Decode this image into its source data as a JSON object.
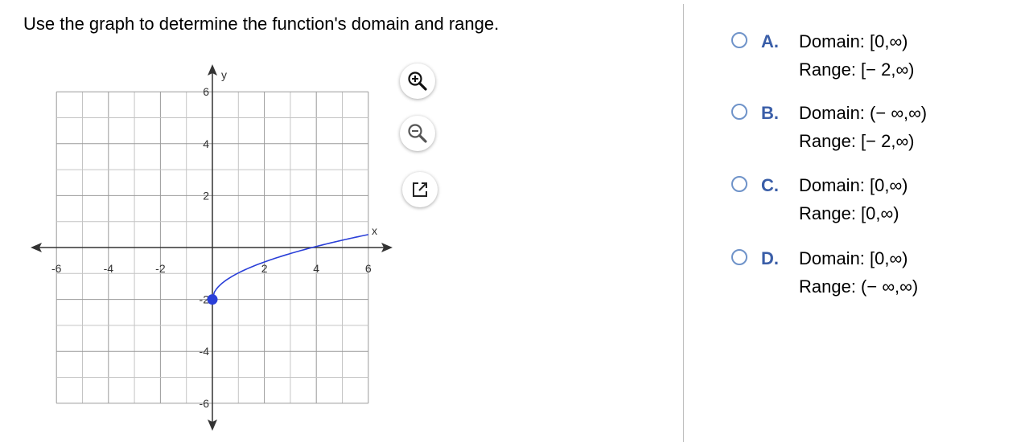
{
  "question": "Use the graph to determine the function's domain and range.",
  "graph": {
    "axis_x_label": "x",
    "axis_y_label": "y",
    "x_ticks": [
      {
        "value": -6,
        "label": "-6"
      },
      {
        "value": -4,
        "label": "-4"
      },
      {
        "value": -2,
        "label": "-2"
      },
      {
        "value": 2,
        "label": "2"
      },
      {
        "value": 4,
        "label": "4"
      },
      {
        "value": 6,
        "label": "6"
      }
    ],
    "y_ticks": [
      {
        "value": 6,
        "label": "6"
      },
      {
        "value": 4,
        "label": "4"
      },
      {
        "value": 2,
        "label": "2"
      },
      {
        "value": -2,
        "label": "-2"
      },
      {
        "value": -4,
        "label": "-4"
      },
      {
        "value": -6,
        "label": "-6"
      }
    ],
    "x_range": [
      -6,
      6
    ],
    "y_range": [
      -6,
      6
    ],
    "curve_start": {
      "x": 0,
      "y": -2
    },
    "curve_end": {
      "x": 6,
      "y": 0.5
    },
    "curve_color": "#2a3fd8",
    "grid": true
  },
  "tools": {
    "zoom_in": "zoom-in-icon",
    "zoom_out": "zoom-out-icon",
    "expand": "expand-icon"
  },
  "choices": [
    {
      "letter": "A.",
      "domain": "Domain: [0,∞)",
      "range": "Range: [− 2,∞)"
    },
    {
      "letter": "B.",
      "domain": "Domain: (− ∞,∞)",
      "range": "Range: [− 2,∞)"
    },
    {
      "letter": "C.",
      "domain": "Domain: [0,∞)",
      "range": "Range: [0,∞)"
    },
    {
      "letter": "D.",
      "domain": "Domain: [0,∞)",
      "range": "Range: (− ∞,∞)"
    }
  ],
  "colors": {
    "accent": "#3a5ea8",
    "radio_border": "#6f93c9",
    "curve": "#2a3fd8"
  }
}
